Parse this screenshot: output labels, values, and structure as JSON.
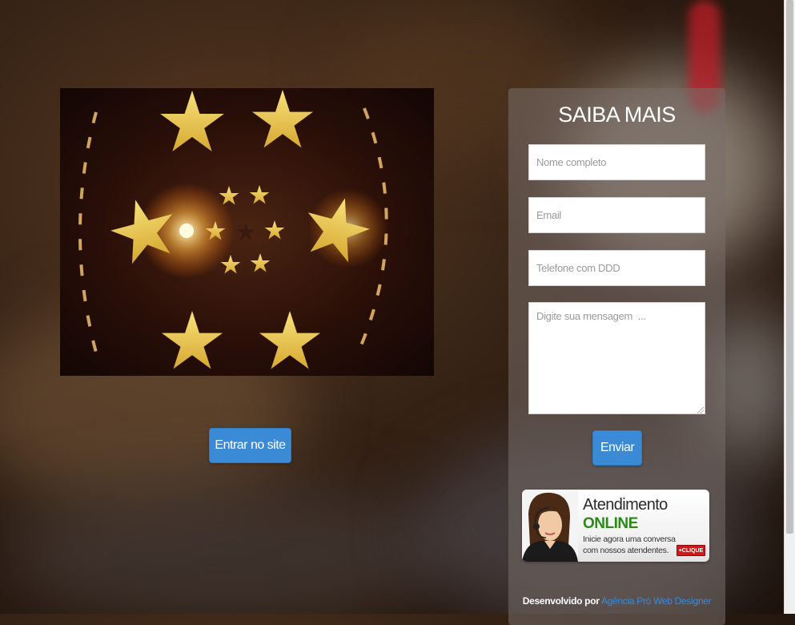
{
  "hero": {
    "image_icon": "stars-kaleidoscope-image"
  },
  "enter_button": {
    "label": "Entrar no site"
  },
  "contact_form": {
    "title": "SAIBA MAIS",
    "name_placeholder": "Nome completo",
    "email_placeholder": "Email",
    "phone_placeholder": "Telefone com DDD",
    "message_placeholder": "Digite sua mensagem  ...",
    "submit_label": "Enviar"
  },
  "chat_banner": {
    "title": "Atendimento",
    "status": "ONLINE",
    "line1": "Inicie agora uma conversa",
    "line2": "com nossos atendentes.",
    "badge": "+CLIQUE",
    "status_color": "#2a8a16"
  },
  "footer": {
    "prefix": "Desenvolvido por",
    "link_text": "Agência Pró Web Designer"
  },
  "colors": {
    "accent": "#3b8ad6",
    "badge": "#d2161b"
  }
}
